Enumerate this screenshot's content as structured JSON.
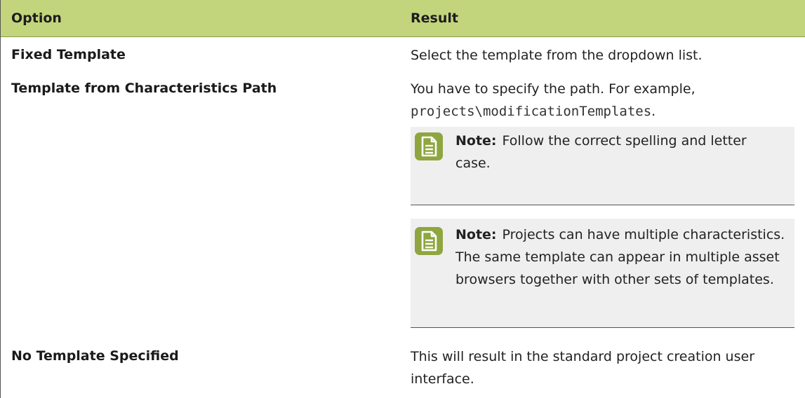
{
  "header": {
    "option": "Option",
    "result": "Result"
  },
  "rows": [
    {
      "option": "Fixed Template",
      "result": "Select the template from the dropdown list."
    },
    {
      "option": "Template from Characteristics Path",
      "result_text": "You have to specify the path. For example,",
      "result_code": "projects\\modificationTemplates",
      "result_suffix": ".",
      "notes": [
        {
          "label": "Note:",
          "text": "Follow the correct spelling and letter case."
        },
        {
          "label": "Note:",
          "text": "Projects can have multiple characteristics. The same template can appear in multiple asset browsers together with other sets of templates."
        }
      ]
    },
    {
      "option": "No Template Specified",
      "result": "This will result in the standard project creation user interface."
    }
  ],
  "colors": {
    "header_bg": "#c3d57c",
    "note_bg": "#efefef",
    "note_icon": "#8fa640"
  },
  "icons": [
    "note-icon"
  ]
}
